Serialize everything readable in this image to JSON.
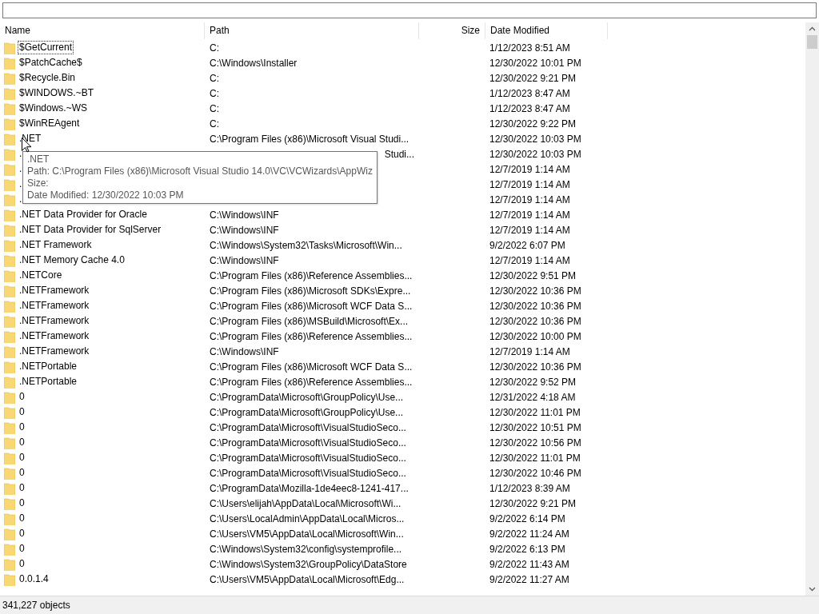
{
  "table": {
    "columns": [
      {
        "label": "Name",
        "kind": "text"
      },
      {
        "label": "Path",
        "kind": "text"
      },
      {
        "label": "Size",
        "kind": "number"
      },
      {
        "label": "Date Modified",
        "kind": "text"
      }
    ],
    "rows": [
      {
        "name": "$GetCurrent",
        "path": "C:",
        "date": "1/12/2023 8:51 AM",
        "focused": true,
        "kind": "full"
      },
      {
        "name": "$PatchCache$",
        "path": "C:\\Windows\\Installer",
        "date": "12/30/2022 10:01 PM",
        "focused": false,
        "kind": "full"
      },
      {
        "name": "$Recycle.Bin",
        "path": "C:",
        "date": "12/30/2022 9:21 PM",
        "focused": false,
        "kind": "full"
      },
      {
        "name": "$WINDOWS.~BT",
        "path": "C:",
        "date": "1/12/2023 8:47 AM",
        "focused": false,
        "kind": "full"
      },
      {
        "name": "$Windows.~WS",
        "path": "C:",
        "date": "1/12/2023 8:47 AM",
        "focused": false,
        "kind": "full"
      },
      {
        "name": "$WinREAgent",
        "path": "C:",
        "date": "12/30/2022 9:22 PM",
        "focused": false,
        "kind": "full"
      },
      {
        "name": ".NET",
        "path": "C:\\Program Files (x86)\\Microsoft Visual Studi...",
        "date": "12/30/2022 10:03 PM",
        "focused": false,
        "kind": "full"
      },
      {
        "name": ".",
        "path": "Studi...",
        "date": "12/30/2022 10:03 PM",
        "focused": false,
        "kind": "covered"
      },
      {
        "name": ".",
        "date": "12/7/2019 1:14 AM",
        "focused": false,
        "kind": "covered"
      },
      {
        "name": ".",
        "date": "12/7/2019 1:14 AM",
        "focused": false,
        "kind": "covered"
      },
      {
        "name": ".",
        "date": "12/7/2019 1:14 AM",
        "focused": false,
        "kind": "covered"
      },
      {
        "name": ".NET Data Provider for Oracle",
        "path": "C:\\Windows\\INF",
        "date": "12/7/2019 1:14 AM",
        "focused": false,
        "kind": "full"
      },
      {
        "name": ".NET Data Provider for SqlServer",
        "path": "C:\\Windows\\INF",
        "date": "12/7/2019 1:14 AM",
        "focused": false,
        "kind": "full"
      },
      {
        "name": ".NET Framework",
        "path": "C:\\Windows\\System32\\Tasks\\Microsoft\\Win...",
        "date": "9/2/2022 6:07 PM",
        "focused": false,
        "kind": "full"
      },
      {
        "name": ".NET Memory Cache 4.0",
        "path": "C:\\Windows\\INF",
        "date": "12/7/2019 1:14 AM",
        "focused": false,
        "kind": "full"
      },
      {
        "name": ".NETCore",
        "path": "C:\\Program Files (x86)\\Reference Assemblies...",
        "date": "12/30/2022 9:51 PM",
        "focused": false,
        "kind": "full"
      },
      {
        "name": ".NETFramework",
        "path": "C:\\Program Files (x86)\\Microsoft SDKs\\Expre...",
        "date": "12/30/2022 10:36 PM",
        "focused": false,
        "kind": "full"
      },
      {
        "name": ".NETFramework",
        "path": "C:\\Program Files (x86)\\Microsoft WCF Data S...",
        "date": "12/30/2022 10:36 PM",
        "focused": false,
        "kind": "full"
      },
      {
        "name": ".NETFramework",
        "path": "C:\\Program Files (x86)\\MSBuild\\Microsoft\\Ex...",
        "date": "12/30/2022 10:36 PM",
        "focused": false,
        "kind": "full"
      },
      {
        "name": ".NETFramework",
        "path": "C:\\Program Files (x86)\\Reference Assemblies...",
        "date": "12/30/2022 10:00 PM",
        "focused": false,
        "kind": "full"
      },
      {
        "name": ".NETFramework",
        "path": "C:\\Windows\\INF",
        "date": "12/7/2019 1:14 AM",
        "focused": false,
        "kind": "full"
      },
      {
        "name": ".NETPortable",
        "path": "C:\\Program Files (x86)\\Microsoft WCF Data S...",
        "date": "12/30/2022 10:36 PM",
        "focused": false,
        "kind": "full"
      },
      {
        "name": ".NETPortable",
        "path": "C:\\Program Files (x86)\\Reference Assemblies...",
        "date": "12/30/2022 9:52 PM",
        "focused": false,
        "kind": "full"
      },
      {
        "name": "0",
        "path": "C:\\ProgramData\\Microsoft\\GroupPolicy\\Use...",
        "date": "12/31/2022 4:18 AM",
        "focused": false,
        "kind": "full"
      },
      {
        "name": "0",
        "path": "C:\\ProgramData\\Microsoft\\GroupPolicy\\Use...",
        "date": "12/30/2022 11:01 PM",
        "focused": false,
        "kind": "full"
      },
      {
        "name": "0",
        "path": "C:\\ProgramData\\Microsoft\\VisualStudioSeco...",
        "date": "12/30/2022 10:51 PM",
        "focused": false,
        "kind": "full"
      },
      {
        "name": "0",
        "path": "C:\\ProgramData\\Microsoft\\VisualStudioSeco...",
        "date": "12/30/2022 10:56 PM",
        "focused": false,
        "kind": "full"
      },
      {
        "name": "0",
        "path": "C:\\ProgramData\\Microsoft\\VisualStudioSeco...",
        "date": "12/30/2022 11:01 PM",
        "focused": false,
        "kind": "full"
      },
      {
        "name": "0",
        "path": "C:\\ProgramData\\Microsoft\\VisualStudioSeco...",
        "date": "12/30/2022 10:46 PM",
        "focused": false,
        "kind": "full"
      },
      {
        "name": "0",
        "path": "C:\\ProgramData\\Mozilla-1de4eec8-1241-417...",
        "date": "1/12/2023 8:39 AM",
        "focused": false,
        "kind": "full"
      },
      {
        "name": "0",
        "path": "C:\\Users\\elijah\\AppData\\Local\\Microsoft\\Wi...",
        "date": "12/30/2022 9:21 PM",
        "focused": false,
        "kind": "full"
      },
      {
        "name": "0",
        "path": "C:\\Users\\LocalAdmin\\AppData\\Local\\Micros...",
        "date": "9/2/2022 6:14 PM",
        "focused": false,
        "kind": "full"
      },
      {
        "name": "0",
        "path": "C:\\Users\\VM5\\AppData\\Local\\Microsoft\\Win...",
        "date": "9/2/2022 11:24 AM",
        "focused": false,
        "kind": "full"
      },
      {
        "name": "0",
        "path": "C:\\Windows\\System32\\config\\systemprofile...",
        "date": "9/2/2022 6:13 PM",
        "focused": false,
        "kind": "full"
      },
      {
        "name": "0",
        "path": "C:\\Windows\\System32\\GroupPolicy\\DataStore",
        "date": "9/2/2022 11:43 AM",
        "focused": false,
        "kind": "full"
      },
      {
        "name": "0.0.1.4",
        "path": "C:\\Users\\VM5\\AppData\\Local\\Microsoft\\Edg...",
        "date": "9/2/2022 11:27 AM",
        "focused": false,
        "kind": "full"
      }
    ]
  },
  "tooltip": {
    "lines": [
      ".NET",
      "Path: C:\\Program Files (x86)\\Microsoft Visual Studio 14.0\\VC\\VCWizards\\AppWiz",
      "Size:",
      "Date Modified: 12/30/2022 10:03 PM"
    ]
  },
  "status_bar": {
    "text": "341,227 objects"
  }
}
